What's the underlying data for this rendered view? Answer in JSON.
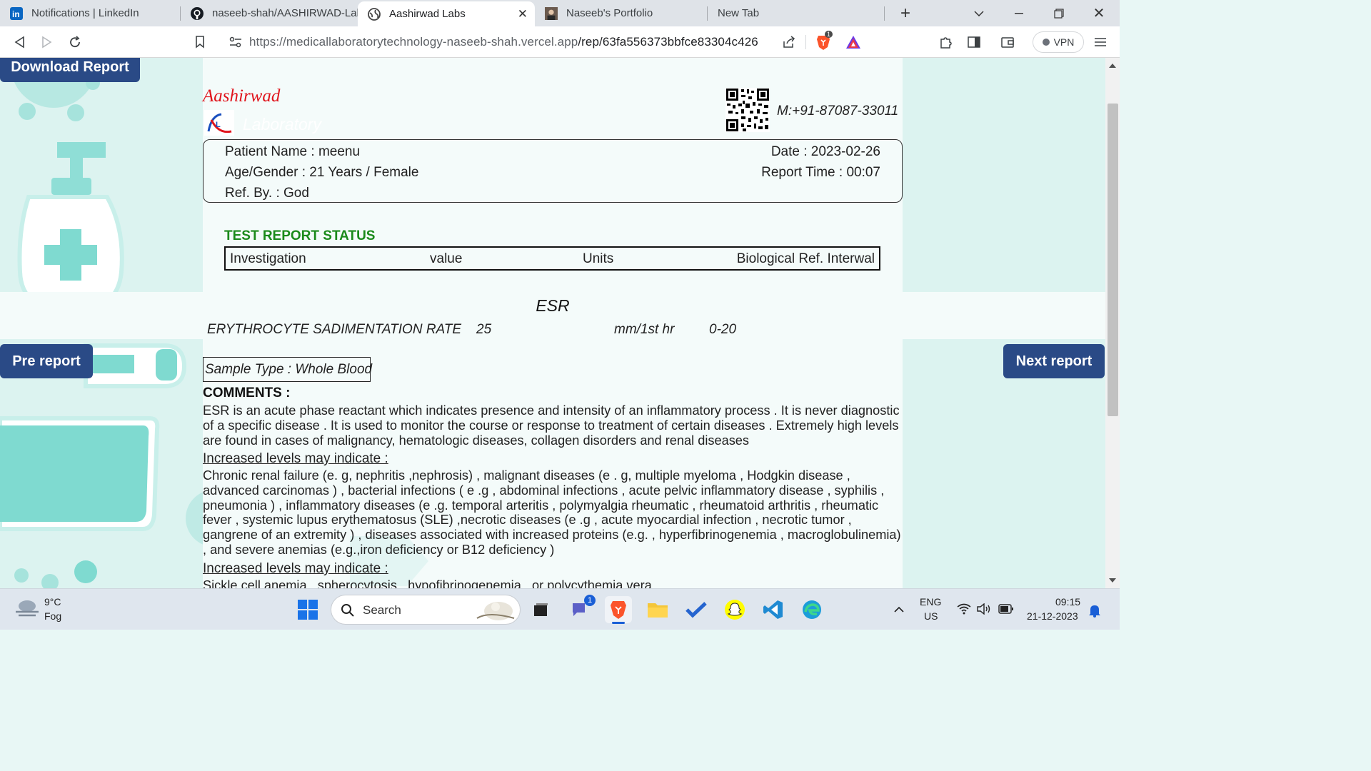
{
  "browser": {
    "tabs": [
      {
        "title": "Notifications | LinkedIn",
        "icon": "linkedin-icon"
      },
      {
        "title": "naseeb-shah/AASHIRWAD-Lab",
        "icon": "github-icon"
      },
      {
        "title": "Aashirwad Labs",
        "icon": "globe-icon",
        "active": true
      },
      {
        "title": "Naseeb's Portfolio",
        "icon": "portrait-icon"
      },
      {
        "title": "New Tab",
        "icon": ""
      }
    ],
    "url_host": "https://medicallaboratorytechnology-naseeb-shah.vercel.app",
    "url_path": "/rep/63fa556373bbfce83304c426",
    "vpn_label": "VPN",
    "brave_badge": "1"
  },
  "page": {
    "download_label": "Download Report",
    "pre_label": "Pre report",
    "next_label": "Next report",
    "lab_name": "Aashirwad",
    "lab_sub": "Laboratory",
    "mobile": "M:+91-87087-33011",
    "patient": {
      "name": "Patient Name : meenu",
      "age_gender": "Age/Gender : 21 Years / Female",
      "ref_by": "Ref. By. : God",
      "date": "Date : 2023-02-26",
      "report_time": "Report Time : 00:07"
    },
    "status_title": "TEST REPORT STATUS",
    "columns": [
      "Investigation",
      "value",
      "Units",
      "Biological Ref. Interwal"
    ],
    "test_title": "ESR",
    "result": {
      "investigation": "ERYTHROCYTE SADIMENTATION RATE",
      "value": "25",
      "units": "mm/1st hr",
      "range": "0-20"
    },
    "sample_type": "Sample Type : Whole Blood",
    "comments_title": "COMMENTS :",
    "comment_1": "ESR is an acute phase reactant which indicates presence and intensity of an inflammatory process . It is never diagnostic of a specific disease . It is used to monitor the course or response to treatment of certain diseases . Extremely high levels are found in cases of malignancy, hematologic diseases, collagen disorders and renal diseases",
    "subhead_1": "Increased levels may indicate :",
    "comment_2": "Chronic renal failure (e. g, nephritis ,nephrosis) , malignant diseases (e . g, multiple myeloma , Hodgkin disease , advanced carcinomas ) , bacterial infections ( e .g , abdominal infections , acute pelvic inflammatory disease , syphilis , pneumonia ) , inflammatory diseases (e .g. temporal arteritis , polymyalgia rheumatic , rheumatoid arthritis , rheumatic fever , systemic lupus erythematosus (SLE) ,necrotic diseases (e .g , acute myocardial infection , necrotic tumor , gangrene of an extremity ) , diseases associated with increased proteins (e.g. , hyperfibrinogenemia , macroglobulinemia) , and severe anemias (e.g.,iron deficiency or B12 deficiency )",
    "subhead_2": "Increased levels may indicate :",
    "comment_3": "Sickle cell anemia , spherocytosis , hypofibrinogenemia , or polycythemia vera"
  },
  "taskbar": {
    "weather_temp": "9°C",
    "weather_desc": "Fog",
    "search_label": "Search",
    "teams_badge": "1",
    "lang": "ENG",
    "region": "US",
    "time": "09:15",
    "date": "21-12-2023"
  }
}
